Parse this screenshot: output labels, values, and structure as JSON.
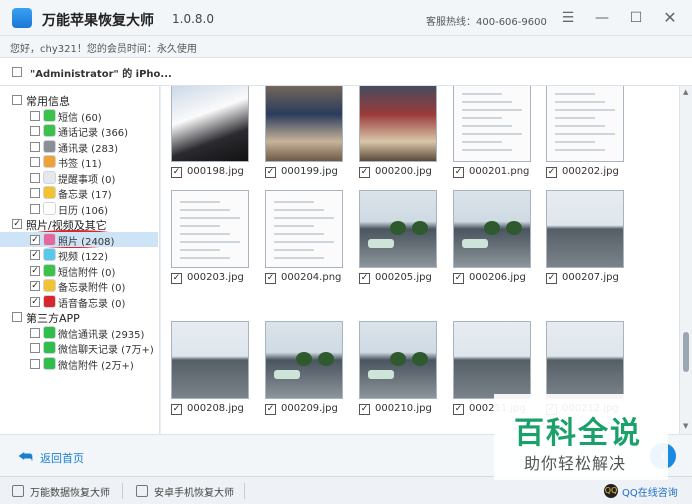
{
  "titlebar": {
    "logo_glyph": "",
    "title": "万能苹果恢复大师",
    "version": "1.0.8.0",
    "hotline": "客服热线：400-606-9600"
  },
  "info": {
    "greeting": "您好，chy321！您的会员时间：永久使用"
  },
  "device": {
    "name": "\"Administrator\" 的 iPho..."
  },
  "sidebar": {
    "groups": [
      {
        "label": "常用信息",
        "checked": false,
        "items": [
          {
            "label": "短信 (60)",
            "checked": false,
            "icon": "sms-icon",
            "color": "#3cc24b"
          },
          {
            "label": "通话记录 (366)",
            "checked": false,
            "icon": "phone-icon",
            "color": "#3cc24b"
          },
          {
            "label": "通讯录 (283)",
            "checked": false,
            "icon": "contacts-icon",
            "color": "#8a8f96"
          },
          {
            "label": "书签 (11)",
            "checked": false,
            "icon": "bookmark-icon",
            "color": "#f0a23a"
          },
          {
            "label": "提醒事项 (0)",
            "checked": false,
            "icon": "reminder-icon",
            "color": "#e5e8ec"
          },
          {
            "label": "备忘录 (17)",
            "checked": false,
            "icon": "notes-icon",
            "color": "#f2c230"
          },
          {
            "label": "日历 (106)",
            "checked": false,
            "icon": "calendar-icon",
            "color": "#ffffff"
          }
        ]
      },
      {
        "label": "照片/视频及其它",
        "checked": true,
        "items": [
          {
            "label": "照片 (2408)",
            "checked": true,
            "icon": "photos-icon",
            "color": "#e06aa0"
          },
          {
            "label": "视频 (122)",
            "checked": true,
            "icon": "video-icon",
            "color": "#5ac8e8"
          },
          {
            "label": "短信附件 (0)",
            "checked": true,
            "icon": "sms-attachment-icon",
            "color": "#3cc24b"
          },
          {
            "label": "备忘录附件 (0)",
            "checked": true,
            "icon": "notes-attachment-icon",
            "color": "#f2c230"
          },
          {
            "label": "语音备忘录 (0)",
            "checked": true,
            "icon": "voice-memo-icon",
            "color": "#d8262c"
          }
        ]
      },
      {
        "label": "第三方APP",
        "checked": false,
        "items": [
          {
            "label": "微信通讯录 (2935)",
            "checked": false,
            "icon": "wechat-icon",
            "color": "#2fbd4b"
          },
          {
            "label": "微信聊天记录 (7万+)",
            "checked": false,
            "icon": "wechat-icon",
            "color": "#2fbd4b"
          },
          {
            "label": "微信附件 (2万+)",
            "checked": false,
            "icon": "wechat-icon",
            "color": "#2fbd4b"
          }
        ]
      }
    ]
  },
  "photos": [
    {
      "name": "000198.jpg",
      "kind": "shelter"
    },
    {
      "name": "000199.jpg",
      "kind": "bus"
    },
    {
      "name": "000200.jpg",
      "kind": "bus2"
    },
    {
      "name": "000201.png",
      "kind": "screen"
    },
    {
      "name": "000202.jpg",
      "kind": "screen"
    },
    {
      "name": "000203.jpg",
      "kind": "screen"
    },
    {
      "name": "000204.png",
      "kind": "screen"
    },
    {
      "name": "000205.jpg",
      "kind": "street"
    },
    {
      "name": "000206.jpg",
      "kind": "street"
    },
    {
      "name": "000207.jpg",
      "kind": "road"
    },
    {
      "name": "000208.jpg",
      "kind": "road"
    },
    {
      "name": "000209.jpg",
      "kind": "street"
    },
    {
      "name": "000210.jpg",
      "kind": "street"
    },
    {
      "name": "000211.jpg",
      "kind": "road"
    },
    {
      "name": "000212.jpg",
      "kind": "road"
    }
  ],
  "bottom": {
    "back_label": "返回首页",
    "back_icon": "back-arrow-icon",
    "next_icon": "next-icon"
  },
  "statusbar": {
    "data_recovery": "万能数据恢复大师",
    "android_recovery": "安卓手机恢复大师",
    "qq_consult": "QQ在线咨询"
  },
  "watermark": {
    "title": "百科全说",
    "subtitle": "助你轻松解决"
  },
  "colors": {
    "accent": "#1a7fd4",
    "selection": "#cfe3f7",
    "highlight_ring": "#d8262c"
  }
}
